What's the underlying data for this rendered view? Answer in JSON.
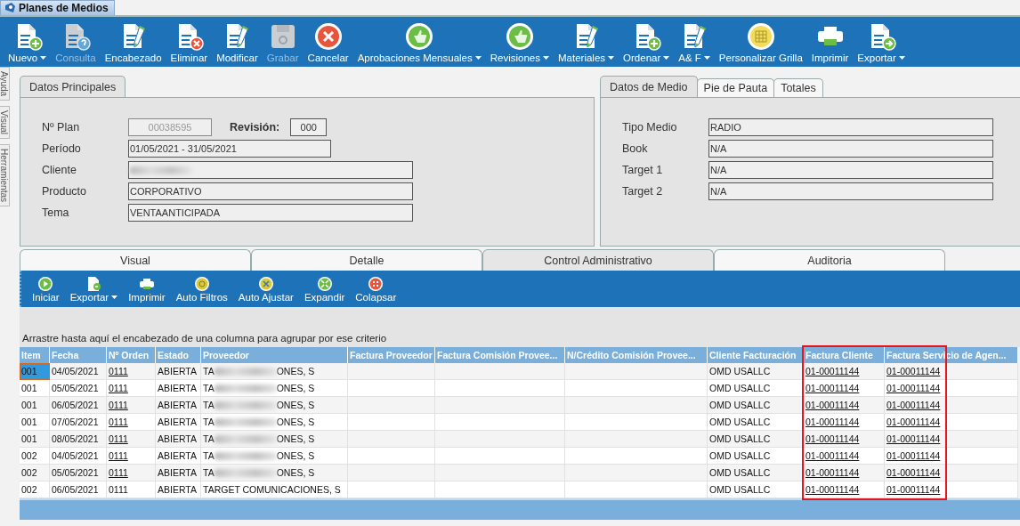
{
  "window": {
    "title": "Planes de Medios"
  },
  "side_tabs": [
    {
      "label": "Ayuda"
    },
    {
      "label": "Visual"
    },
    {
      "label": "Herramientas"
    }
  ],
  "toolbar": [
    {
      "label": "Nuevo",
      "kind": "doc-plus",
      "disabled": false,
      "dropdown": true
    },
    {
      "label": "Consulta",
      "kind": "doc-help",
      "disabled": true,
      "dropdown": false
    },
    {
      "label": "Encabezado",
      "kind": "doc-pencil",
      "disabled": false,
      "dropdown": false
    },
    {
      "label": "Eliminar",
      "kind": "doc-x",
      "disabled": false,
      "dropdown": false
    },
    {
      "label": "Modificar",
      "kind": "doc-pencil",
      "disabled": false,
      "dropdown": false
    },
    {
      "label": "Grabar",
      "kind": "floppy",
      "disabled": true,
      "dropdown": false
    },
    {
      "label": "Cancelar",
      "kind": "cancel",
      "disabled": false,
      "dropdown": false
    },
    {
      "label": "Aprobaciones Mensuales",
      "kind": "thumbs",
      "disabled": false,
      "dropdown": true
    },
    {
      "label": "Revisiones",
      "kind": "thumbs",
      "disabled": false,
      "dropdown": true
    },
    {
      "label": "Materiales",
      "kind": "doc-pencil",
      "disabled": false,
      "dropdown": true
    },
    {
      "label": "Ordenar",
      "kind": "doc-plus",
      "disabled": false,
      "dropdown": true
    },
    {
      "label": "A& F",
      "kind": "doc-pencil",
      "disabled": false,
      "dropdown": true
    },
    {
      "label": "Personalizar Grilla",
      "kind": "grid",
      "disabled": false,
      "dropdown": false
    },
    {
      "label": "Imprimir",
      "kind": "printer",
      "disabled": false,
      "dropdown": false
    },
    {
      "label": "Exportar",
      "kind": "doc-arrow",
      "disabled": false,
      "dropdown": true
    }
  ],
  "main_panel": {
    "tabs": [
      {
        "label": "Datos Principales",
        "selected": true
      }
    ],
    "plan": {
      "label": "Nº Plan",
      "value": "00038595",
      "disabled": true,
      "revision_label": "Revisión:",
      "revision": "000"
    },
    "fields": [
      {
        "label": "Período",
        "value": "01/05/2021 - 31/05/2021",
        "kind": "medium"
      },
      {
        "label": "Cliente",
        "kind": "redacted"
      },
      {
        "label": "Producto",
        "value": "CORPORATIVO",
        "kind": "long"
      },
      {
        "label": "Tema",
        "value": "VENTAANTICIPADA",
        "kind": "long"
      }
    ]
  },
  "media_panel": {
    "tabs": [
      {
        "label": "Datos de Medio",
        "selected": true
      },
      {
        "label": "Pie de Pauta",
        "selected": false
      },
      {
        "label": "Totales",
        "selected": false
      }
    ],
    "fields": [
      {
        "label": "Tipo Medio",
        "value": "RADIO"
      },
      {
        "label": "Book",
        "value": "N/A"
      },
      {
        "label": "Target 1",
        "value": "N/A"
      },
      {
        "label": "Target 2",
        "value": "N/A"
      }
    ]
  },
  "detail_tabs": [
    {
      "label": "Visual",
      "selected": false
    },
    {
      "label": "Detalle",
      "selected": false
    },
    {
      "label": "Control Administrativo",
      "selected": true
    },
    {
      "label": "Auditoria",
      "selected": false
    }
  ],
  "grid_toolbar": [
    {
      "label": "Iniciar",
      "kind": "play",
      "dropdown": false
    },
    {
      "label": "Exportar",
      "kind": "doc-arrow",
      "dropdown": true
    },
    {
      "label": "Imprimir",
      "kind": "printer",
      "dropdown": false
    },
    {
      "label": "Auto Filtros",
      "kind": "filter",
      "dropdown": false
    },
    {
      "label": "Auto Ajustar",
      "kind": "fit",
      "dropdown": false
    },
    {
      "label": "Expandir",
      "kind": "expand",
      "dropdown": false
    },
    {
      "label": "Colapsar",
      "kind": "collapse",
      "dropdown": false
    }
  ],
  "group_hint": "Arrastre hasta aquí el encabezado de una columna para agrupar por ese criterio",
  "table": {
    "columns": [
      {
        "label": "Item",
        "highlighted": false
      },
      {
        "label": "Fecha",
        "highlighted": false
      },
      {
        "label": "Nº Orden",
        "highlighted": false
      },
      {
        "label": "Estado",
        "highlighted": false
      },
      {
        "label": "Proveedor",
        "highlighted": false
      },
      {
        "label": "Factura Proveedor",
        "highlighted": false
      },
      {
        "label": "Factura Comisión Provee...",
        "highlighted": false
      },
      {
        "label": "N/Crédito Comisión Provee...",
        "highlighted": false
      },
      {
        "label": "Cliente Facturación",
        "highlighted": false
      },
      {
        "label": "Factura Cliente",
        "highlighted": true
      },
      {
        "label": "Factura Servicio de Agen...",
        "highlighted": true
      }
    ],
    "rows": [
      {
        "item": "001",
        "fecha": "04/05/2021",
        "orden": "0111",
        "orden_linked": true,
        "estado": "ABIERTA",
        "proveedor": {
          "start": "TA",
          "end": "ONES, S",
          "redacted": true
        },
        "cliente_facturacion": "OMD USALLC",
        "factura_cliente": "01-00011144",
        "factura_servicio": "01-00011144",
        "selected": true
      },
      {
        "item": "001",
        "fecha": "05/05/2021",
        "orden": "0111",
        "orden_linked": true,
        "estado": "ABIERTA",
        "proveedor": {
          "start": "TA",
          "end": "ONES, S",
          "redacted": true
        },
        "cliente_facturacion": "OMD USALLC",
        "factura_cliente": "01-00011144",
        "factura_servicio": "01-00011144",
        "selected": false
      },
      {
        "item": "001",
        "fecha": "06/05/2021",
        "orden": "0111",
        "orden_linked": true,
        "estado": "ABIERTA",
        "proveedor": {
          "start": "TA",
          "end": "ONES, S",
          "redacted": true
        },
        "cliente_facturacion": "OMD USALLC",
        "factura_cliente": "01-00011144",
        "factura_servicio": "01-00011144",
        "selected": false
      },
      {
        "item": "001",
        "fecha": "07/05/2021",
        "orden": "0111",
        "orden_linked": true,
        "estado": "ABIERTA",
        "proveedor": {
          "start": "TA",
          "end": "ONES, S",
          "redacted": true
        },
        "cliente_facturacion": "OMD USALLC",
        "factura_cliente": "01-00011144",
        "factura_servicio": "01-00011144",
        "selected": false
      },
      {
        "item": "001",
        "fecha": "08/05/2021",
        "orden": "0111",
        "orden_linked": true,
        "estado": "ABIERTA",
        "proveedor": {
          "start": "TA",
          "end": "ONES, S",
          "redacted": true
        },
        "cliente_facturacion": "OMD USALLC",
        "factura_cliente": "01-00011144",
        "factura_servicio": "01-00011144",
        "selected": false
      },
      {
        "item": "002",
        "fecha": "04/05/2021",
        "orden": "0111",
        "orden_linked": true,
        "estado": "ABIERTA",
        "proveedor": {
          "start": "TA",
          "end": "ONES, S",
          "redacted": true
        },
        "cliente_facturacion": "OMD USALLC",
        "factura_cliente": "01-00011144",
        "factura_servicio": "01-00011144",
        "selected": false
      },
      {
        "item": "002",
        "fecha": "05/05/2021",
        "orden": "0111",
        "orden_linked": true,
        "estado": "ABIERTA",
        "proveedor": {
          "start": "TA",
          "end": "ONES, S",
          "redacted": true
        },
        "cliente_facturacion": "OMD USALLC",
        "factura_cliente": "01-00011144",
        "factura_servicio": "01-00011144",
        "selected": false
      },
      {
        "item": "002",
        "fecha": "06/05/2021",
        "orden": "0111",
        "orden_linked": false,
        "estado": "ABIERTA",
        "proveedor": {
          "start": "TARGET COMUNICACIONES, S",
          "redacted": false
        },
        "cliente_facturacion": "OMD USALLC",
        "factura_cliente": "01-00011144",
        "factura_servicio": "01-00011144",
        "selected": false
      }
    ]
  }
}
